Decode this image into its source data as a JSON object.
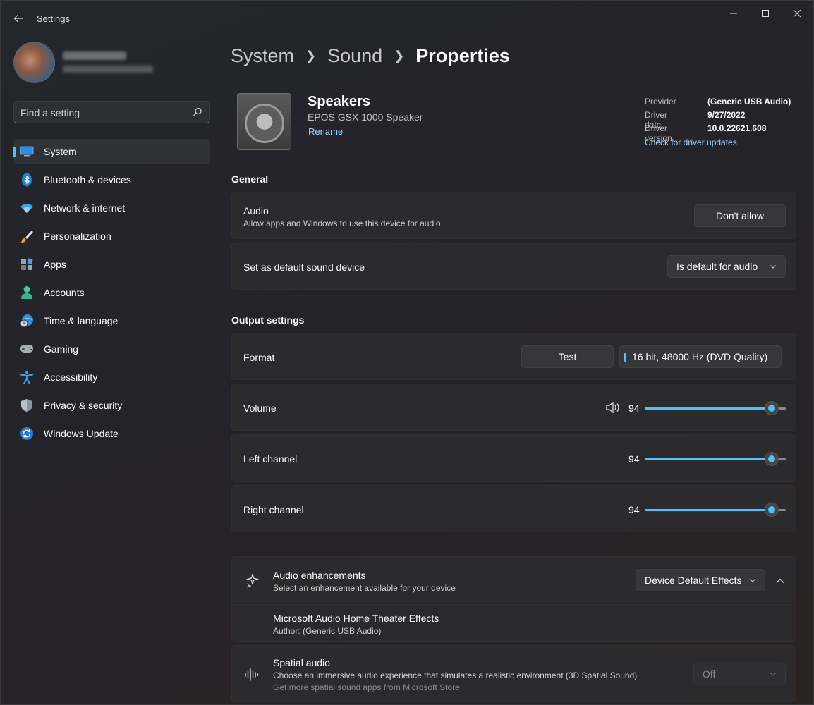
{
  "window": {
    "title": "Settings"
  },
  "search": {
    "placeholder": "Find a setting"
  },
  "sidebar": {
    "items": [
      {
        "label": "System",
        "icon": "system-icon"
      },
      {
        "label": "Bluetooth & devices",
        "icon": "bluetooth-icon"
      },
      {
        "label": "Network & internet",
        "icon": "wifi-icon"
      },
      {
        "label": "Personalization",
        "icon": "brush-icon"
      },
      {
        "label": "Apps",
        "icon": "apps-icon"
      },
      {
        "label": "Accounts",
        "icon": "person-icon"
      },
      {
        "label": "Time & language",
        "icon": "globe-clock-icon"
      },
      {
        "label": "Gaming",
        "icon": "gamepad-icon"
      },
      {
        "label": "Accessibility",
        "icon": "accessibility-icon"
      },
      {
        "label": "Privacy & security",
        "icon": "shield-icon"
      },
      {
        "label": "Windows Update",
        "icon": "update-icon"
      }
    ]
  },
  "breadcrumb": {
    "level1": "System",
    "level2": "Sound",
    "level3": "Properties"
  },
  "device": {
    "name": "Speakers",
    "model": "EPOS GSX 1000 Speaker",
    "rename": "Rename"
  },
  "driver": {
    "provider_label": "Provider",
    "provider_value": "(Generic USB Audio)",
    "date_label": "Driver date",
    "date_value": "9/27/2022",
    "version_label": "Driver version",
    "version_value": "10.0.22621.608",
    "update_link": "Check for driver updates"
  },
  "general": {
    "title": "General",
    "audio_label": "Audio",
    "audio_desc": "Allow apps and Windows to use this device for audio",
    "audio_button": "Don't allow",
    "default_label": "Set as default sound device",
    "default_value": "Is default for audio"
  },
  "output": {
    "title": "Output settings",
    "format_label": "Format",
    "test_button": "Test",
    "format_value": "16 bit, 48000 Hz (DVD Quality)",
    "volume_label": "Volume",
    "volume_value": "94",
    "left_label": "Left channel",
    "left_value": "94",
    "right_label": "Right channel",
    "right_value": "94"
  },
  "enhancements": {
    "title": "Audio enhancements",
    "desc": "Select an enhancement available for your device",
    "value": "Device Default Effects",
    "effect_name": "Microsoft Audio Home Theater Effects",
    "effect_author": "Author: (Generic USB Audio)"
  },
  "spatial": {
    "title": "Spatial audio",
    "desc": "Choose an immersive audio experience that simulates a realistic environment (3D Spatial Sound)",
    "link": "Get more spatial sound apps from Microsoft Store",
    "value": "Off"
  },
  "colors": {
    "accent": "#4cc2ff",
    "link": "#9fd3ff"
  }
}
